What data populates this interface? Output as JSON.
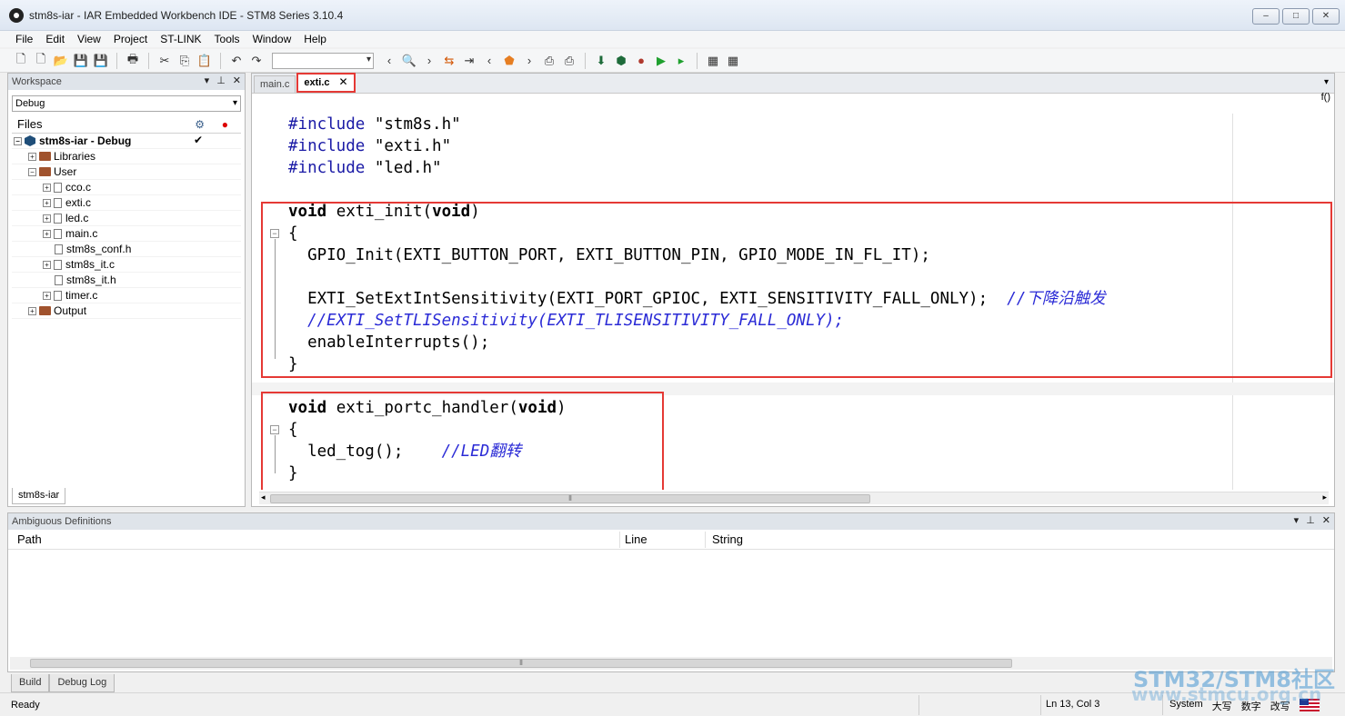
{
  "window": {
    "title": "stm8s-iar - IAR Embedded Workbench IDE - STM8 Series 3.10.4",
    "min": "–",
    "max": "□",
    "close": "✕"
  },
  "menu": [
    "File",
    "Edit",
    "View",
    "Project",
    "ST-LINK",
    "Tools",
    "Window",
    "Help"
  ],
  "workspace": {
    "title": "Workspace",
    "config": "Debug",
    "files_header": "Files",
    "project": "stm8s-iar - Debug",
    "tree": [
      {
        "label": "Libraries",
        "type": "folder",
        "level": 1
      },
      {
        "label": "User",
        "type": "folder",
        "level": 1
      },
      {
        "label": "cco.c",
        "type": "file",
        "level": 2
      },
      {
        "label": "exti.c",
        "type": "file",
        "level": 2
      },
      {
        "label": "led.c",
        "type": "file",
        "level": 2
      },
      {
        "label": "main.c",
        "type": "file",
        "level": 2
      },
      {
        "label": "stm8s_conf.h",
        "type": "header",
        "level": 2
      },
      {
        "label": "stm8s_it.c",
        "type": "file",
        "level": 2
      },
      {
        "label": "stm8s_it.h",
        "type": "header",
        "level": 2
      },
      {
        "label": "timer.c",
        "type": "file",
        "level": 2
      },
      {
        "label": "Output",
        "type": "folder",
        "level": 1
      }
    ],
    "bottom_tab": "stm8s-iar"
  },
  "editor": {
    "tabs": [
      "main.c",
      "exti.c"
    ],
    "active_tab": "exti.c",
    "fx": "f()",
    "lines": {
      "l1a": "#include",
      "l1b": " \"stm8s.h\"",
      "l2a": "#include",
      "l2b": " \"exti.h\"",
      "l3a": "#include",
      "l3b": " \"led.h\"",
      "l5a": "void",
      "l5b": " exti_init(",
      "l5c": "void",
      "l5d": ")",
      "l6": "{",
      "l7": "  GPIO_Init(EXTI_BUTTON_PORT, EXTI_BUTTON_PIN, GPIO_MODE_IN_FL_IT);",
      "l9a": "  EXTI_SetExtIntSensitivity(EXTI_PORT_GPIOC, EXTI_SENSITIVITY_FALL_ONLY);  ",
      "l9b": "//下降沿触发",
      "l10": "  //EXTI_SetTLISensitivity(EXTI_TLISENSITIVITY_FALL_ONLY);",
      "l11": "  enableInterrupts();",
      "l12": "}",
      "l14a": "void",
      "l14b": " exti_portc_handler(",
      "l14c": "void",
      "l14d": ")",
      "l15": "{",
      "l16a": "  led_tog();    ",
      "l16b": "//LED翻转",
      "l17": "}"
    }
  },
  "ambiguous": {
    "title": "Ambiguous Definitions",
    "columns": [
      "Path",
      "Line",
      "String"
    ]
  },
  "bottom_tabs": [
    "Build",
    "Debug Log"
  ],
  "status": {
    "ready": "Ready",
    "position": "Ln 13, Col 3",
    "ime": [
      "System",
      "大写",
      "数字",
      "改写"
    ]
  },
  "watermark": "STM32/STM8社区",
  "watermark_url": "www.stmcu.org.cn",
  "colors": {
    "highlight_box": "#e53935",
    "preprocessor": "#1a1aa6",
    "comment": "#2b2bd6"
  }
}
